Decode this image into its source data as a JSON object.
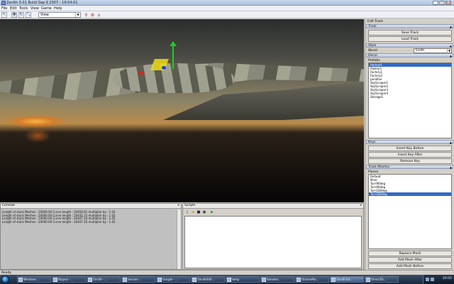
{
  "window": {
    "title": "Zenith 0.01 Build Sep 9 2007 - 19:54:01",
    "controls": [
      "_",
      "□",
      "X"
    ]
  },
  "menu": [
    "File",
    "Edit",
    "Tools",
    "View",
    "Game",
    "Help"
  ],
  "toolbar": {
    "view_select": "View",
    "buttons": [
      "select-icon",
      "move-icon",
      "rotate-icon",
      "scale-icon"
    ],
    "extra_icons": [
      "bone-icon",
      "gear-icon",
      "lock-icon"
    ]
  },
  "right_panel": {
    "title": "Edit Track",
    "track_section": "Track",
    "save_track": "Save Track",
    "load_track": "Load Track",
    "style_section": "Style",
    "world_label": "World",
    "world_value": "Earth",
    "decor_section": "Decor",
    "prefabs_label": "Prefabs",
    "prefabs": [
      "Helmet1",
      "Pauley3",
      "Factory1",
      "Factory2",
      "parallax",
      "SkyScraper1",
      "SkyScraper2",
      "SkyScraper3",
      "SkyScraper4",
      "Storage1"
    ],
    "prefabs_selected_index": 0,
    "keys_section": "Keys",
    "insert_before": "Insert Key Before",
    "insert_after": "Insert Key After",
    "remove_key": "Remove Key",
    "meshes_section": "Track Meshes",
    "meshes_label": "Pieces",
    "meshes": [
      "Default",
      "Mine",
      "Turn90deg",
      "Turn90deg",
      "Turn180deg",
      "Turn180deg"
    ],
    "meshes_selected_index": 5,
    "replace_mesh": "Replace Mesh",
    "add_mesh_after": "Add Mesh After",
    "add_mesh_before": "Add Mesh Before"
  },
  "console": {
    "title": "Console",
    "lines": [
      "Length of stack Meshes : 20000.00  Curve length : 20450.61  multiplier by : 1.02",
      "Length of stack Meshes : 20000.00  Curve length : 20432.15  multiplier by : 1.02",
      "Length of stack Meshes : 20000.00  Curve length : 20447.34  multiplier by : 1.02",
      "Length of stack Meshes : 20000.00  Curve length : 20447.26  multiplier by : 1.02"
    ]
  },
  "scripts": {
    "title": "Scripts",
    "buttons": [
      "new-file-icon",
      "open-file-icon",
      "save-file-icon",
      "save-all-icon",
      "run-icon"
    ]
  },
  "status": "Ready",
  "taskbar": {
    "items": [
      "Windows ...",
      "Bagnal - ...",
      "Zenith - ...",
      "session ...",
      "Google - ...",
      "ZenithEdit...",
      "temp",
      "Sonoleo...",
      "OctaneMo...",
      "Zenith Ed...",
      "Direct3D..."
    ],
    "active_index": 9,
    "clock": "20:05"
  }
}
